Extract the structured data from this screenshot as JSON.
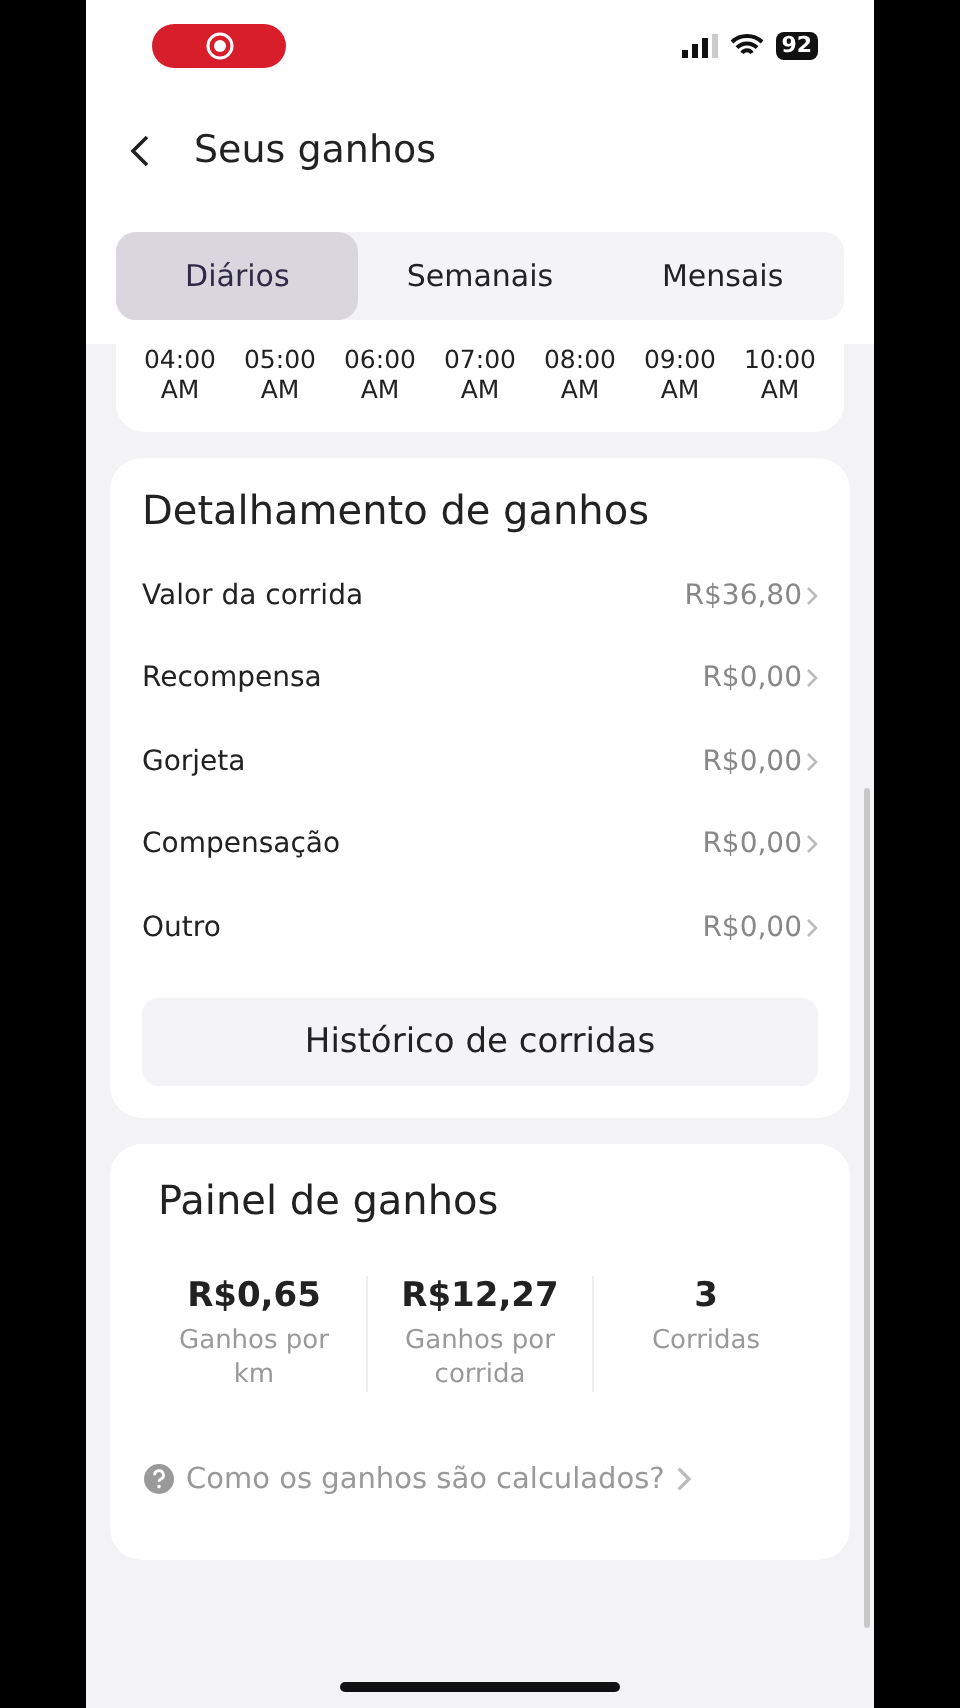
{
  "status_bar": {
    "battery": "92"
  },
  "header": {
    "title": "Seus ganhos"
  },
  "tabs": [
    {
      "label": "Diários",
      "selected": true
    },
    {
      "label": "Semanais",
      "selected": false
    },
    {
      "label": "Mensais",
      "selected": false
    }
  ],
  "time_axis": [
    {
      "time": "04:00",
      "period": "AM"
    },
    {
      "time": "05:00",
      "period": "AM"
    },
    {
      "time": "06:00",
      "period": "AM"
    },
    {
      "time": "07:00",
      "period": "AM"
    },
    {
      "time": "08:00",
      "period": "AM"
    },
    {
      "time": "09:00",
      "period": "AM"
    },
    {
      "time": "10:00",
      "period": "AM"
    }
  ],
  "breakdown": {
    "title": "Detalhamento de ganhos",
    "rows": [
      {
        "label": "Valor da corrida",
        "value": "R$36,80"
      },
      {
        "label": "Recompensa",
        "value": "R$0,00"
      },
      {
        "label": "Gorjeta",
        "value": "R$0,00"
      },
      {
        "label": "Compensação",
        "value": "R$0,00"
      },
      {
        "label": "Outro",
        "value": "R$0,00"
      }
    ],
    "button": "Histórico de corridas"
  },
  "panel": {
    "title": "Painel de ganhos",
    "stats": [
      {
        "value": "R$0,65",
        "label": "Ganhos por km"
      },
      {
        "value": "R$12,27",
        "label": "Ganhos por corrida"
      },
      {
        "value": "3",
        "label": "Corridas"
      }
    ],
    "help_link": "Como os ganhos são calculados?"
  }
}
